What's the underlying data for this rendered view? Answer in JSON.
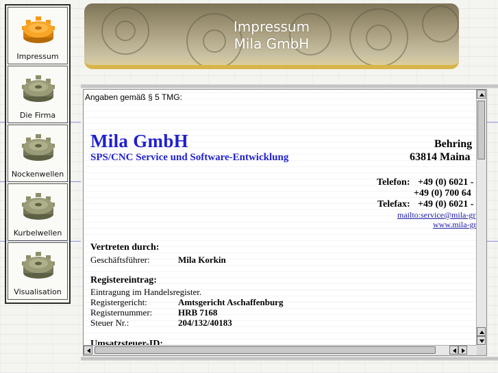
{
  "nav": {
    "items": [
      {
        "label": "Impressum",
        "icon": "gear-orange-icon",
        "active": true
      },
      {
        "label": "Die Firma",
        "icon": "gear-icon",
        "active": false
      },
      {
        "label": "Nockenwellen",
        "icon": "gear-icon",
        "active": false
      },
      {
        "label": "Kurbelwellen",
        "icon": "gear-icon",
        "active": false
      },
      {
        "label": "Visualisation",
        "icon": "gear-icon",
        "active": false
      }
    ]
  },
  "banner": {
    "line1": "Impressum",
    "line2": "Mila GmbH"
  },
  "content": {
    "intro": "Angaben gemäß § 5 TMG:",
    "company": "Mila GmbH",
    "tagline": "SPS/CNC Service und Software-Entwicklung",
    "address_line1": "Behring",
    "address_line2": "63814 Maina",
    "phone_label": "Telefon:",
    "phone1": "+49 (0) 6021 -",
    "phone2": "+49 (0) 700 64",
    "fax_label": "Telefax:",
    "fax": "+49 (0) 6021 -",
    "mail_link": "mailto:service@mila-gr",
    "web_link": "www.mila-gr",
    "represented_title": "Vertreten durch:",
    "ceo_label": "Geschäftsführer:",
    "ceo_value": "Mila Korkin",
    "register_title": "Registereintrag:",
    "register_text": "Eintragung im Handelsregister.",
    "court_label": "Registergericht:",
    "court_value": "Amtsgericht Aschaffenburg",
    "regnum_label": "Registernummer:",
    "regnum_value": "HRB 7168",
    "tax_label": "Steuer Nr.:",
    "tax_value": "204/132/40183",
    "vat_title": "Umsatzsteuer-ID:"
  },
  "colors": {
    "company_blue": "#1f1fd0",
    "link_blue": "#1a1aa8",
    "banner_gold": "#d7b54a",
    "gear_orange": "#f39a1a",
    "gear_olive": "#8d8f69"
  }
}
